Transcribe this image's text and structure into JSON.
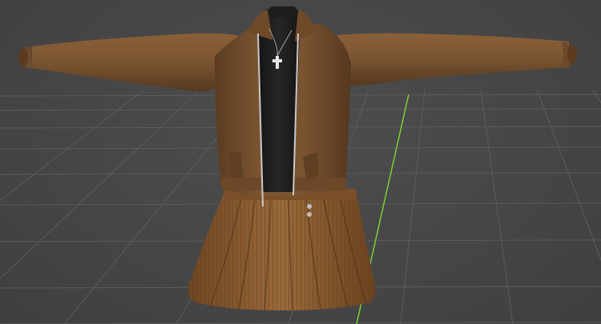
{
  "scene": {
    "background_color": "#474747",
    "grid_color": "#5c5c5c",
    "axis_color": "#7fcf2f",
    "object": "jacket-and-skirt-outfit",
    "colors": {
      "jacket": "#7a5431",
      "jacket_shadow": "#4e331b",
      "jacket_highlight": "#9a6f45",
      "shirt": "#1b1b1b",
      "skirt": "#8a5b30",
      "skirt_stripe": "#6a431f",
      "zipper": "#c9c9c9",
      "pendant": "#e8e8e8"
    }
  }
}
